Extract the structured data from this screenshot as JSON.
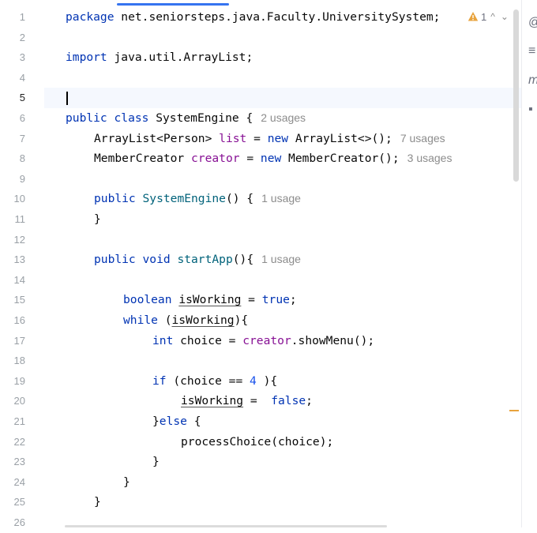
{
  "gutter": {
    "line_numbers": [
      "1",
      "2",
      "3",
      "4",
      "5",
      "6",
      "7",
      "8",
      "9",
      "10",
      "11",
      "12",
      "13",
      "14",
      "15",
      "16",
      "17",
      "18",
      "19",
      "20",
      "21",
      "22",
      "23",
      "24",
      "25",
      "26"
    ],
    "current_line": "5"
  },
  "code": {
    "l1": {
      "kw": "package",
      "text": " net.seniorsteps.java.Faculty.UniversitySystem;"
    },
    "l3": {
      "kw": "import",
      "text": " java.util.ArrayList;"
    },
    "l6": {
      "kw": "public class",
      "text": " SystemEngine {",
      "hint": "2 usages"
    },
    "l7": {
      "type": "ArrayList<Person>",
      "field": "list",
      "eq": " = ",
      "kw": "new",
      "rest": " ArrayList<>();",
      "hint": "7 usages"
    },
    "l8": {
      "type": "MemberCreator",
      "field": "creator",
      "eq": " = ",
      "kw": "new",
      "rest": " MemberCreator();",
      "hint": "3 usages"
    },
    "l10": {
      "kw": "public",
      "method": "SystemEngine",
      "rest": "() {",
      "hint": "1 usage"
    },
    "l11": {
      "text": "}"
    },
    "l13": {
      "kw": "public void",
      "method": "startApp",
      "rest": "(){",
      "hint": "1 usage"
    },
    "l15": {
      "kw": "boolean",
      "var": "isWorking",
      "eq": " = ",
      "val": "true",
      "end": ";"
    },
    "l16": {
      "kw": "while",
      "open": " (",
      "var": "isWorking",
      "close": "){"
    },
    "l17": {
      "kw": "int",
      "text": " choice = ",
      "field": "creator",
      "rest": ".showMenu();"
    },
    "l19": {
      "kw": "if",
      "text": " (choice == ",
      "num": "4",
      "rest": " ){"
    },
    "l20": {
      "var": "isWorking",
      "eq": " =  ",
      "val": "false",
      "end": ";"
    },
    "l21": {
      "brace": "}",
      "kw": "else",
      "rest": " {"
    },
    "l22": {
      "text": "processChoice(choice);"
    },
    "l23": {
      "text": "}"
    },
    "l24": {
      "text": "}"
    },
    "l25": {
      "text": "}"
    }
  },
  "inspection": {
    "icon": "warning-icon",
    "count": "1",
    "prev": "^",
    "next": "⌄",
    "color": "#e8a33d"
  },
  "right_toolbar": {
    "icons": [
      "ai-assistant-icon",
      "database-icon",
      "maven-icon",
      "plugin-icon"
    ],
    "glyphs": [
      "@",
      "≡",
      "m",
      "▪"
    ]
  }
}
